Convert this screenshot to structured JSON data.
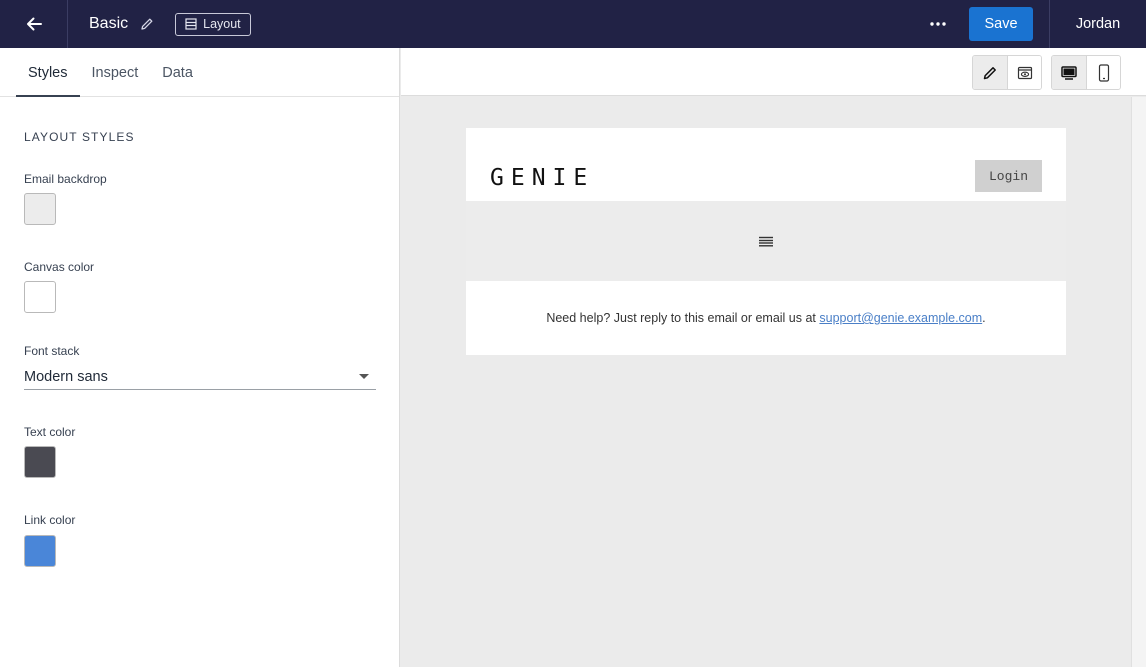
{
  "header": {
    "title": "Basic",
    "layout_label": "Layout",
    "save_label": "Save",
    "user_name": "Jordan"
  },
  "tabs": [
    {
      "label": "Styles",
      "active": true
    },
    {
      "label": "Inspect",
      "active": false
    },
    {
      "label": "Data",
      "active": false
    }
  ],
  "layout_styles": {
    "section_title": "LAYOUT STYLES",
    "email_backdrop": {
      "label": "Email backdrop",
      "color": "#ececec"
    },
    "canvas_color": {
      "label": "Canvas color",
      "color": "#ffffff"
    },
    "font_stack": {
      "label": "Font stack",
      "value": "Modern sans"
    },
    "text_color": {
      "label": "Text color",
      "color": "#4a4a52"
    },
    "link_color": {
      "label": "Link color",
      "color": "#4a86d8"
    }
  },
  "toolbar": {
    "icons": [
      "pencil-icon",
      "eye-icon",
      "desktop-icon",
      "mobile-icon"
    ],
    "active_mode": "edit",
    "active_device": "desktop"
  },
  "email_preview": {
    "logo_text": "GENIE",
    "login_label": "Login",
    "menu_icon": "hamburger-icon",
    "footer_text": "Need help? Just reply to this email or email us at ",
    "footer_link": "support@genie.example.com",
    "footer_end": "."
  },
  "colors": {
    "topbar": "#212245",
    "save_button": "#1a73d1",
    "link": "#4a7fc7"
  }
}
